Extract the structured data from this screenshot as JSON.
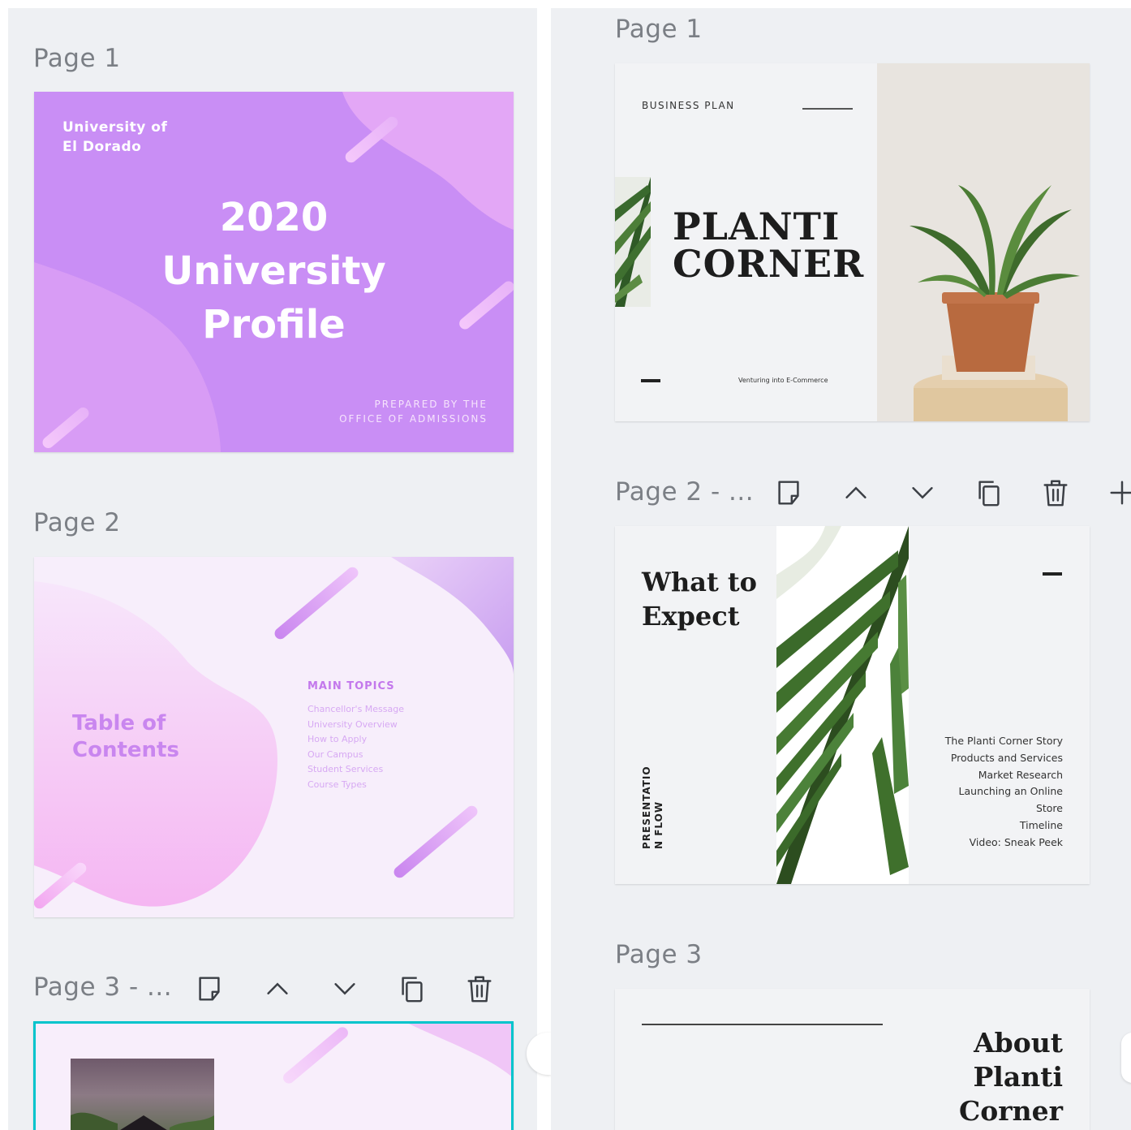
{
  "left": {
    "pages": [
      {
        "label": "Page 1"
      },
      {
        "label": "Page 2"
      },
      {
        "label": "Page 3 - ..."
      }
    ],
    "slide1": {
      "org": "University of\nEl Dorado",
      "title_line1": "2020",
      "title_line2": "University",
      "title_line3": "Profile",
      "footer_line1": "PREPARED BY THE",
      "footer_line2": "OFFICE OF ADMISSIONS"
    },
    "slide2": {
      "title": "Table of\nContents",
      "topics_heading": "MAIN TOPICS",
      "topics": [
        "Chancellor's Message",
        "University Overview",
        "How to Apply",
        "Our Campus",
        "Student Services",
        "Course Types"
      ]
    }
  },
  "right": {
    "pages": [
      {
        "label": "Page 1"
      },
      {
        "label": "Page 2 - ..."
      },
      {
        "label": "Page 3"
      }
    ],
    "slide1": {
      "kicker": "BUSINESS PLAN",
      "title_line1": "PLANTI",
      "title_line2": "CORNER",
      "tagline": "Venturing into E-Commerce"
    },
    "slide2": {
      "title_line1": "What to",
      "title_line2": "Expect",
      "vertical_label": "PRESENTATIO\nN FLOW",
      "items": [
        "The Planti Corner Story",
        "Products and Services",
        "Market Research",
        "Launching an Online",
        "Store",
        "Timeline",
        "Video: Sneak Peek"
      ]
    },
    "slide3": {
      "title_line1": "About",
      "title_line2": "Planti",
      "title_line3": "Corner"
    }
  },
  "toolbar": {
    "icons": [
      "add-note-icon",
      "move-up-icon",
      "move-down-icon",
      "duplicate-icon",
      "delete-icon",
      "add-page-icon"
    ]
  },
  "colors": {
    "panel_bg": "#eef0f3",
    "purple": "#c98ef5",
    "selection": "#00c4cc",
    "label": "#7b7f85"
  }
}
